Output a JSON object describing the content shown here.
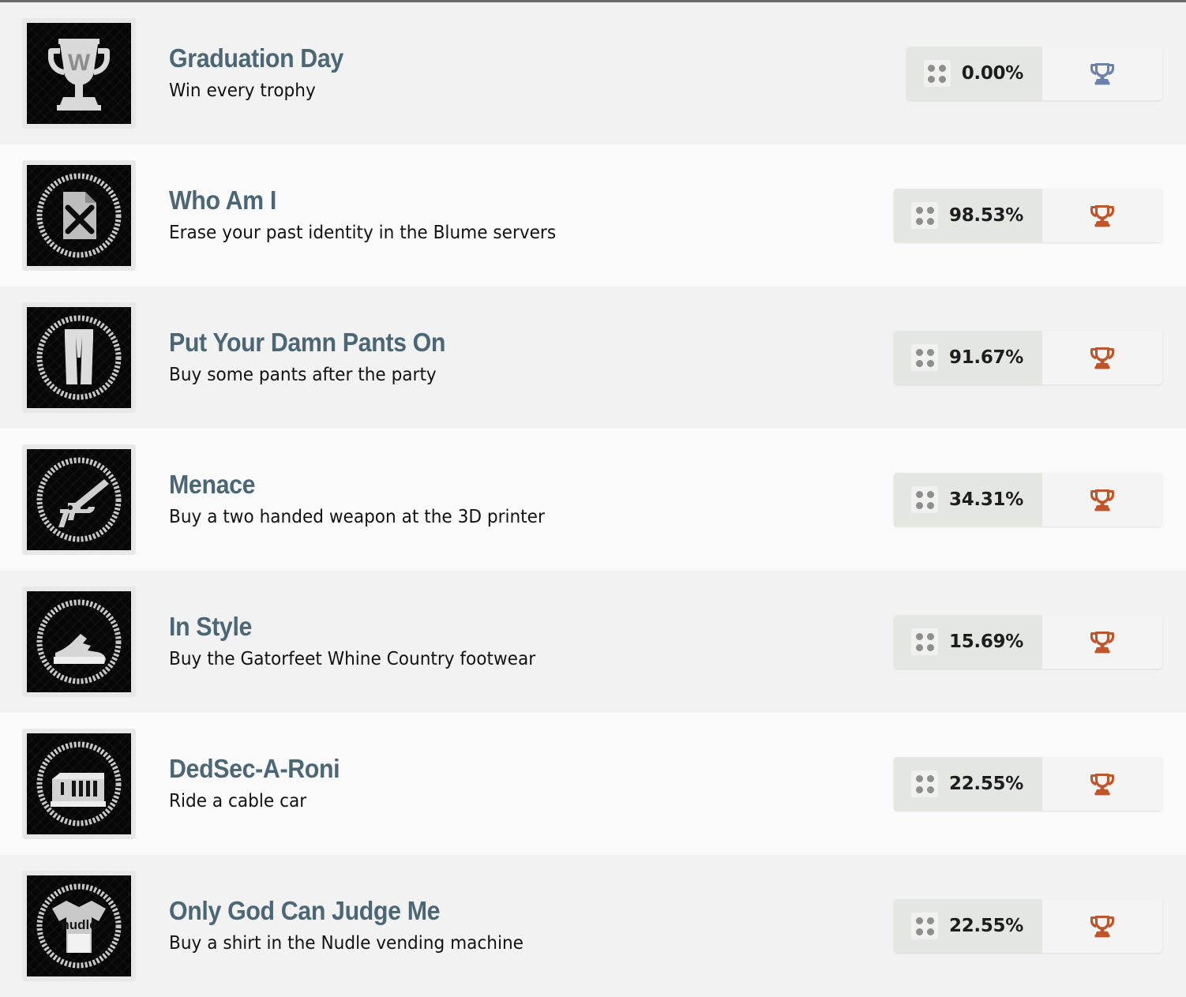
{
  "list": {
    "name": "trophy-achievement-list",
    "rows": [
      {
        "title": "Graduation Day",
        "description": "Win every trophy",
        "rate": "0.00%",
        "icon": "trophy-cup-icon",
        "trophy_type": "platinum",
        "trophy_color": "#6d82ab",
        "row_shade": "dark"
      },
      {
        "title": "Who Am I",
        "description": "Erase your past identity in the Blume servers",
        "rate": "98.53%",
        "icon": "document-x-icon",
        "trophy_type": "bronze",
        "trophy_color": "#c0552a",
        "row_shade": "light"
      },
      {
        "title": "Put Your Damn Pants On",
        "description": "Buy some pants after the party",
        "rate": "91.67%",
        "icon": "pants-icon",
        "trophy_type": "bronze",
        "trophy_color": "#c0552a",
        "row_shade": "dark"
      },
      {
        "title": "Menace",
        "description": "Buy a two handed weapon at the 3D printer",
        "rate": "34.31%",
        "icon": "rifle-icon",
        "trophy_type": "bronze",
        "trophy_color": "#c0552a",
        "row_shade": "light"
      },
      {
        "title": "In Style",
        "description": "Buy the Gatorfeet Whine Country footwear",
        "rate": "15.69%",
        "icon": "sneaker-icon",
        "trophy_type": "bronze",
        "trophy_color": "#c0552a",
        "row_shade": "dark"
      },
      {
        "title": "DedSec-A-Roni",
        "description": "Ride a cable car",
        "rate": "22.55%",
        "icon": "cable-car-icon",
        "trophy_type": "bronze",
        "trophy_color": "#c0552a",
        "row_shade": "light"
      },
      {
        "title": "Only God Can Judge Me",
        "description": "Buy a shirt in the Nudle vending machine",
        "rate": "22.55%",
        "icon": "nudle-shirt-icon",
        "trophy_type": "bronze",
        "trophy_color": "#c0552a",
        "row_shade": "dark"
      }
    ]
  },
  "colors": {
    "title": "#4b6674",
    "description": "#121212",
    "row_dark": "#f2f2f2",
    "row_light": "#fafafa",
    "badge_rate_bg": "#e4e6e2",
    "badge_type_bg": "#f4f4f4",
    "platinum_trophy": "#6d82ab",
    "bronze_trophy": "#c0552a",
    "top_border": "#6b6b6b"
  },
  "icons": {
    "rate_grid": "four-dot-grid-icon",
    "trophy": "trophy-icon"
  }
}
